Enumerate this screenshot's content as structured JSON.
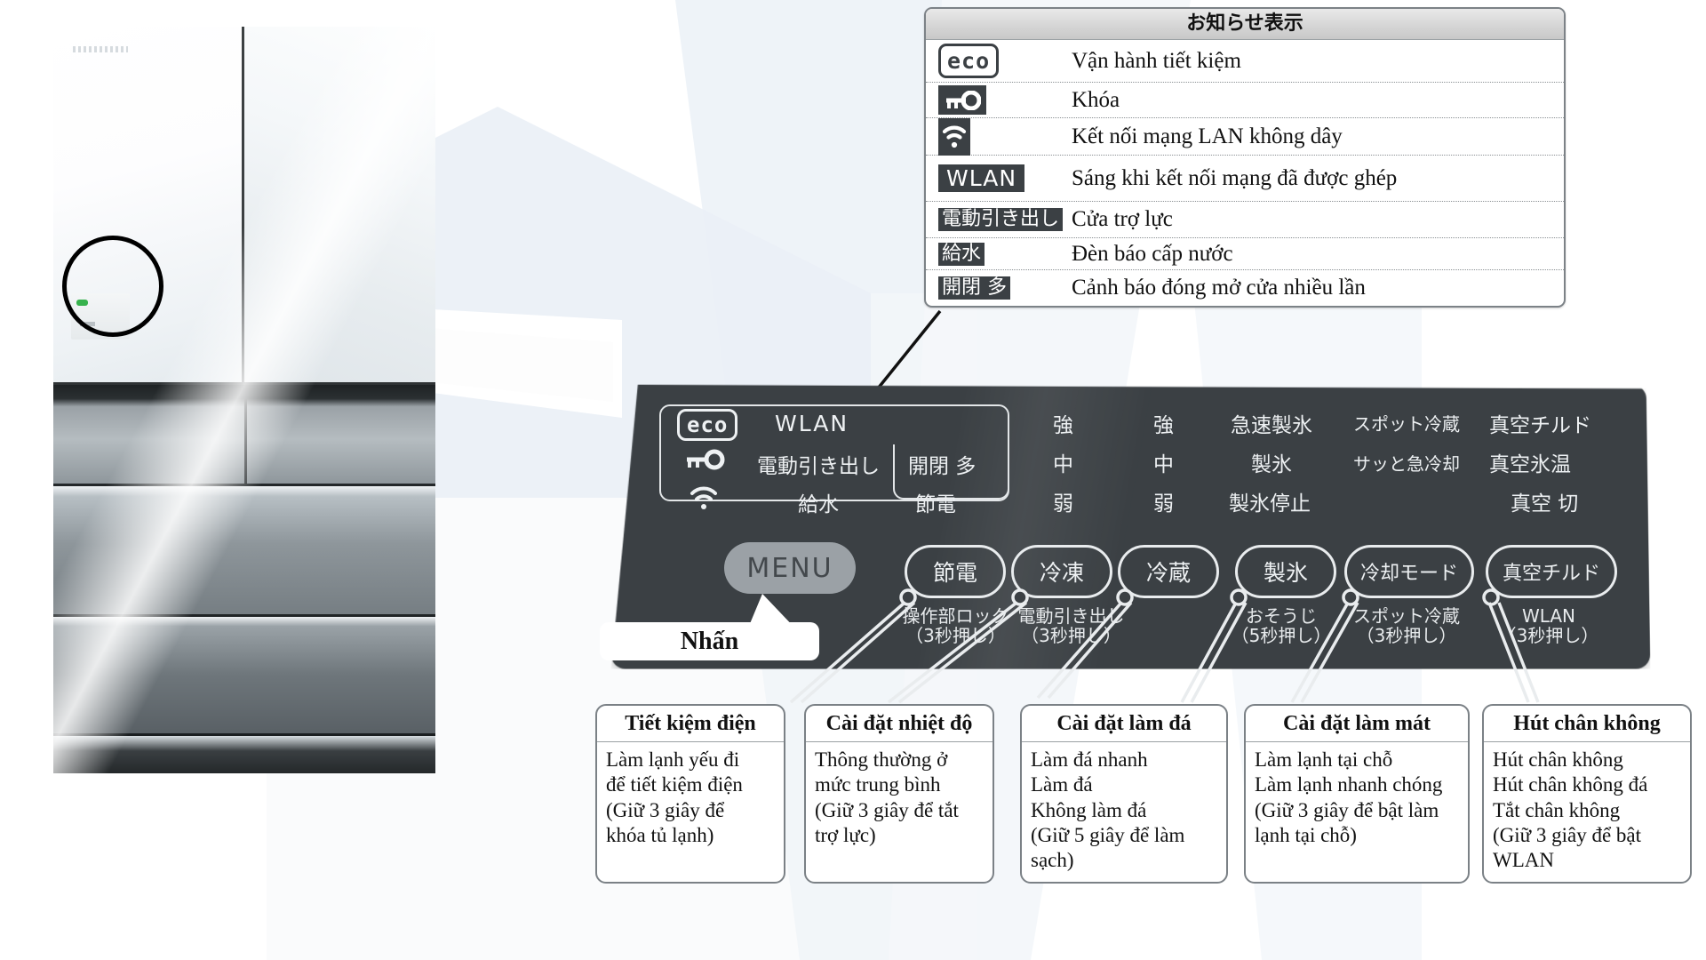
{
  "legend": {
    "title": "お知らせ表示",
    "rows": [
      {
        "icon": "eco-icon",
        "icon_text": "eco",
        "text": "Vận hành tiết kiệm"
      },
      {
        "icon": "key-lock-icon",
        "icon_text": "",
        "text": "Khóa"
      },
      {
        "icon": "wifi-icon",
        "icon_text": "",
        "text": "Kết nối mạng LAN không dây"
      },
      {
        "icon": "wlan-badge-icon",
        "icon_text": "WLAN",
        "text": "Sáng khi kết nối mạng đã được ghép"
      },
      {
        "icon": "power-drawer-badge-icon",
        "icon_text": "電動引き出し",
        "text": "Cửa trợ lực"
      },
      {
        "icon": "water-supply-badge-icon",
        "icon_text": "給水",
        "text": "Đèn báo cấp nước"
      },
      {
        "icon": "door-open-close-badge-icon",
        "icon_text": "開閉 多",
        "text": "Cảnh báo đóng mở cửa nhiều lần"
      }
    ]
  },
  "panel": {
    "indicators": {
      "eco": "eco",
      "wlan": "WLAN",
      "power_drawer": "電動引き出し",
      "water_supply": "給水",
      "door_open_close": "開閉 多",
      "power_save": "節電",
      "col_freezer": [
        "強",
        "中",
        "弱"
      ],
      "col_fridge": [
        "強",
        "中",
        "弱"
      ],
      "col_ice": [
        "急速製氷",
        "製氷",
        "製氷停止"
      ],
      "col_cool_mode": [
        "スポット冷蔵",
        "サッと急冷却"
      ],
      "col_vacuum": [
        "真空チルド",
        "真空氷温",
        "真空 切"
      ]
    },
    "menu_button": "MENU",
    "buttons": [
      {
        "label": "節電",
        "sub1": "操作部ロック",
        "sub2": "（3秒押し）"
      },
      {
        "label": "冷凍",
        "sub1": "電動引き出し",
        "sub2": "（3秒押し）"
      },
      {
        "label": "冷蔵",
        "sub1": "",
        "sub2": ""
      },
      {
        "label": "製氷",
        "sub1": "おそうじ",
        "sub2": "（5秒押し）"
      },
      {
        "label": "冷却モード",
        "sub1": "スポット冷蔵",
        "sub2": "（3秒押し）"
      },
      {
        "label": "真空チルド",
        "sub1": "WLAN",
        "sub2": "（3秒押し）"
      }
    ],
    "press_balloon": "Nhấn"
  },
  "cards": [
    {
      "title": "Tiết kiệm điện",
      "lines": [
        "Làm lạnh yếu đi",
        "để tiết kiệm điện",
        "(Giữ 3 giây để",
        "khóa tủ lạnh)"
      ]
    },
    {
      "title": "Cài đặt nhiệt độ",
      "lines": [
        "Thông thường ở",
        "mức trung bình",
        "(Giữ 3 giây để tắt",
        "trợ lực)"
      ]
    },
    {
      "title": "Cài đặt làm đá",
      "lines": [
        "Làm đá nhanh",
        "Làm đá",
        "Không làm đá",
        "(Giữ 5 giây để làm",
        "sạch)"
      ]
    },
    {
      "title": "Cài đặt làm mát",
      "lines": [
        "Làm lạnh tại chỗ",
        "Làm lạnh nhanh chóng",
        "(Giữ 3 giây để bật làm",
        "lạnh tại chỗ)"
      ]
    },
    {
      "title": "Hút chân không",
      "lines": [
        "Hút chân không",
        "Hút chân không đá",
        "Tắt chân không",
        "(Giữ 3 giây để bật",
        "WLAN"
      ]
    }
  ],
  "colors": {
    "panel_dark": "#3b4044",
    "badge_dark": "#3b4044",
    "led_green": "#37b24d",
    "card_border": "#7b8186",
    "legend_header": "#d6d6d6"
  }
}
